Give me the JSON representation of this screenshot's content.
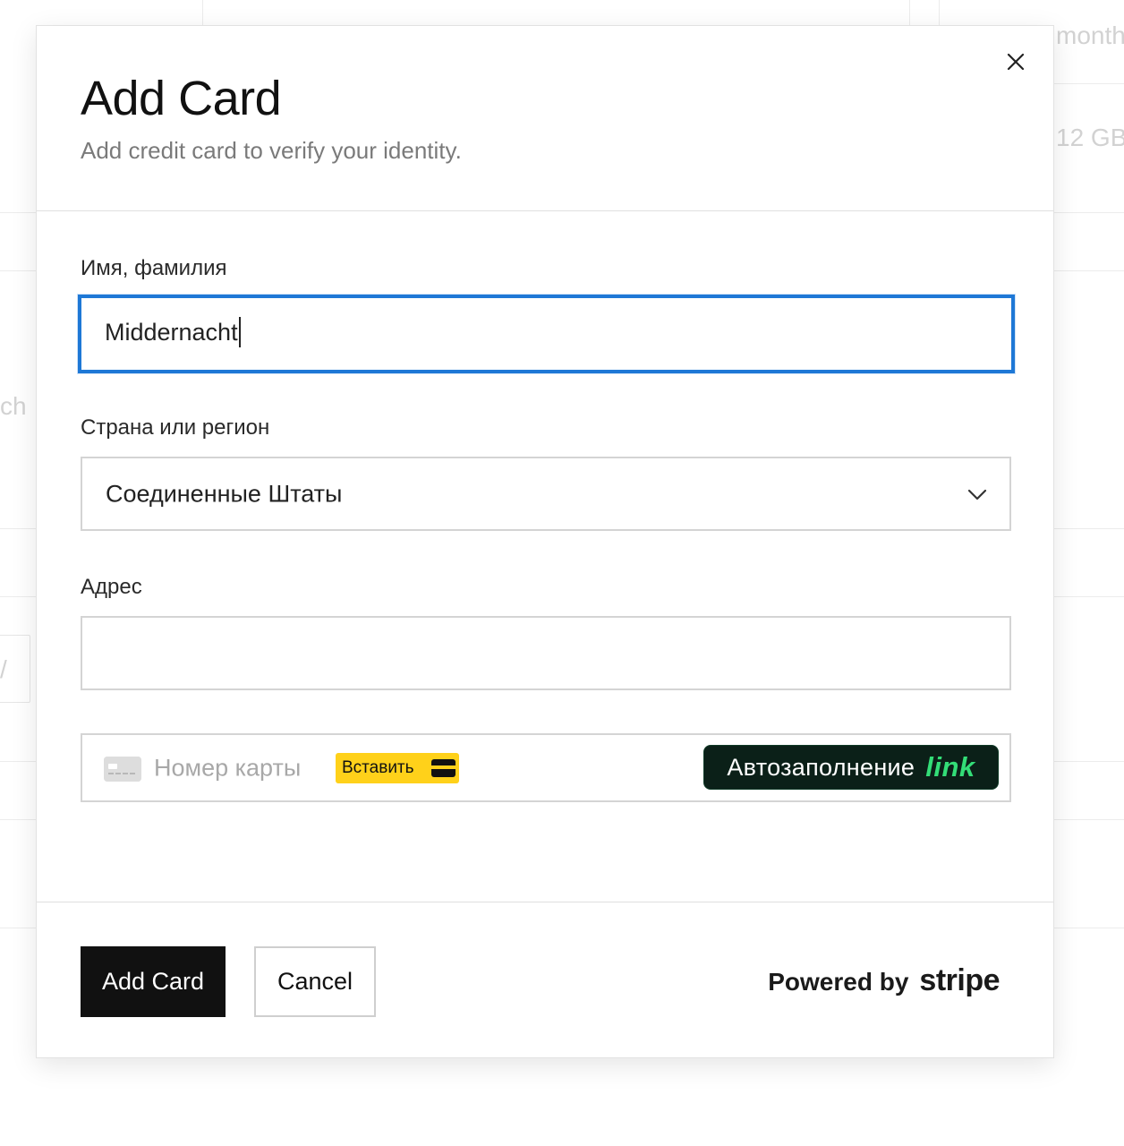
{
  "background": {
    "texts": [
      "month",
      "12 GB",
      "ch",
      "/"
    ]
  },
  "modal": {
    "title": "Add Card",
    "subtitle": "Add credit card to verify your identity.",
    "close_icon": "close-icon"
  },
  "form": {
    "name": {
      "label": "Имя, фамилия",
      "value": "Middernacht"
    },
    "country": {
      "label": "Страна или регион",
      "selected": "Соединенные Штаты",
      "icon": "chevron-down-icon"
    },
    "address": {
      "label": "Адрес",
      "value": ""
    },
    "card": {
      "placeholder": "Номер карты",
      "paste_label": "Вставить",
      "autofill_label": "Автозаполнение",
      "link_brand": "link",
      "colors": {
        "paste_bg": "#ffd11a",
        "link_bg": "#0b2018",
        "link_brand": "#33dd77"
      }
    }
  },
  "footer": {
    "add_card_label": "Add Card",
    "cancel_label": "Cancel",
    "powered_by": "Powered by",
    "stripe": "stripe"
  },
  "colors": {
    "focus_border": "#1e78d6",
    "primary_button": "#111111"
  }
}
